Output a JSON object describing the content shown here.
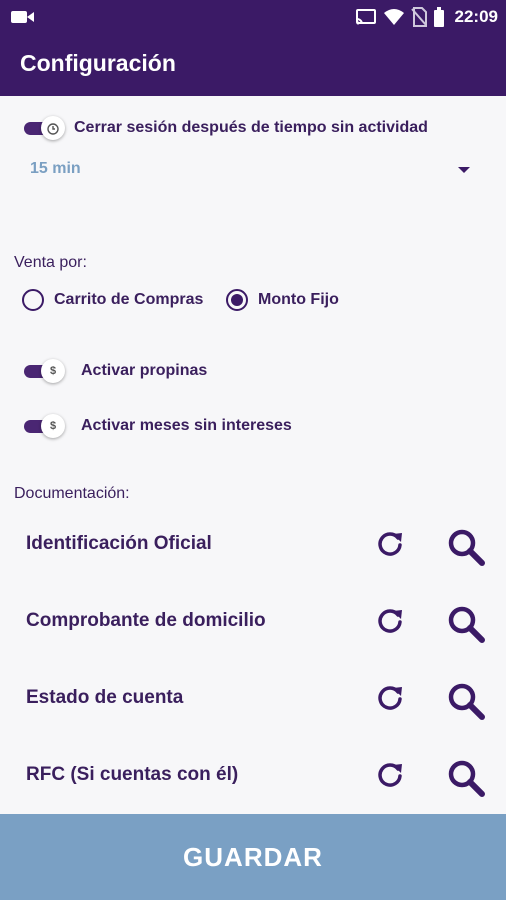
{
  "status_bar": {
    "time": "22:09",
    "icons": [
      "video-camera-icon",
      "cast-icon",
      "wifi-icon",
      "no-sim-icon",
      "battery-icon"
    ]
  },
  "app_bar": {
    "title": "Configuración"
  },
  "session": {
    "toggle_label": "Cerrar sesión después de tiempo sin actividad",
    "toggle_on": true,
    "timeout_value": "15 min"
  },
  "sale": {
    "heading": "Venta por:",
    "options": [
      {
        "label": "Carrito de Compras",
        "selected": false
      },
      {
        "label": "Monto Fijo",
        "selected": true
      }
    ]
  },
  "toggles": [
    {
      "label": "Activar propinas",
      "on": true,
      "thumb_symbol": "$"
    },
    {
      "label": "Activar meses sin intereses",
      "on": true,
      "thumb_symbol": "$"
    }
  ],
  "documents": {
    "heading": "Documentación:",
    "items": [
      {
        "label": "Identificación Oficial"
      },
      {
        "label": "Comprobante de domicilio"
      },
      {
        "label": "Estado de cuenta"
      },
      {
        "label": "RFC (Si cuentas con él)"
      }
    ]
  },
  "save_button": {
    "label": "GUARDAR"
  },
  "colors": {
    "primary": "#3b1a66",
    "accent_blue": "#7aa0c4",
    "select_text": "#7a9fc2",
    "background": "#f7f7f9"
  }
}
